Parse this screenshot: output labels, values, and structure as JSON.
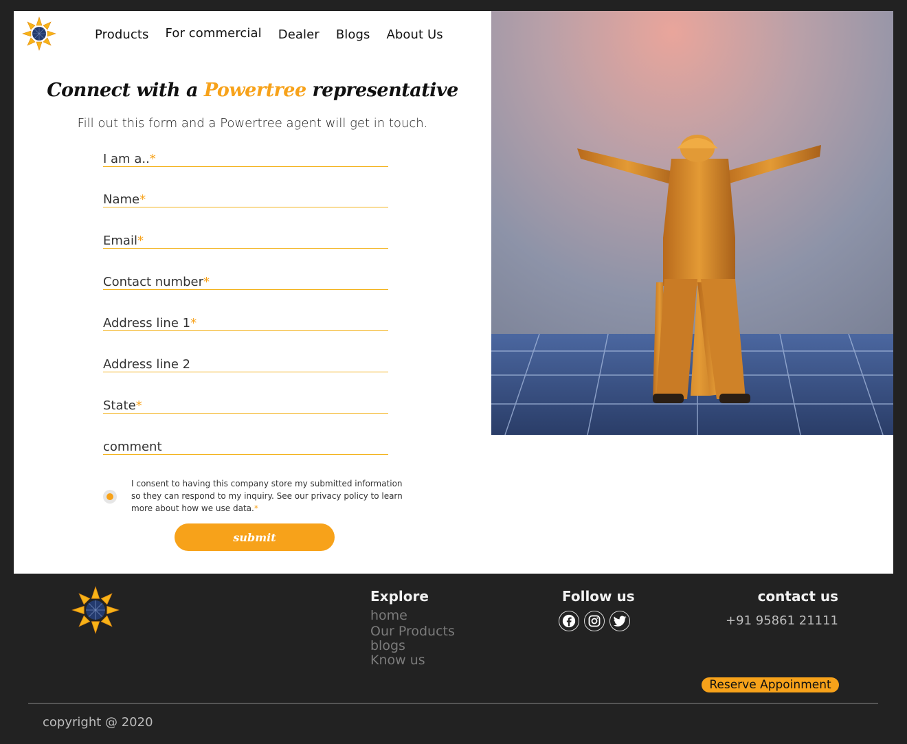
{
  "nav": {
    "items": [
      "Products",
      "For commercial",
      "Dealer",
      "Blogs",
      "About Us"
    ]
  },
  "form": {
    "headline_pre": "Connect with a ",
    "headline_brand": "Powertree",
    "headline_post": " representative",
    "subhead": "Fill out this form and a Powertree agent will get in touch.",
    "fields": [
      {
        "label": "I am a..",
        "required": "*"
      },
      {
        "label": "Name",
        "required": "*"
      },
      {
        "label": "Email",
        "required": "*"
      },
      {
        "label": "Contact number",
        "required": "*"
      },
      {
        "label": "Address line 1",
        "required": "*"
      },
      {
        "label": "Address line 2",
        "required": ""
      },
      {
        "label": "State",
        "required": "*"
      },
      {
        "label": "comment",
        "required": ""
      }
    ],
    "consent_text": "I consent to having this company store my submitted information so they can respond to my inquiry. See our privacy policy to learn more about how we use data.",
    "consent_required": "*",
    "submit_label": "submit"
  },
  "footer": {
    "explore_heading": "Explore",
    "explore_links": [
      "home",
      "Our Products",
      "blogs",
      "Know us"
    ],
    "follow_heading": "Follow us",
    "social_icons": [
      "facebook-icon",
      "instagram-icon",
      "twitter-icon"
    ],
    "contact_heading": "contact us",
    "phone": "+91 95861 21111",
    "reserve_label": "Reserve Appoinment",
    "copyright": "copyright @ 2020"
  },
  "colors": {
    "accent": "#f7a21a",
    "background": "#222222"
  }
}
